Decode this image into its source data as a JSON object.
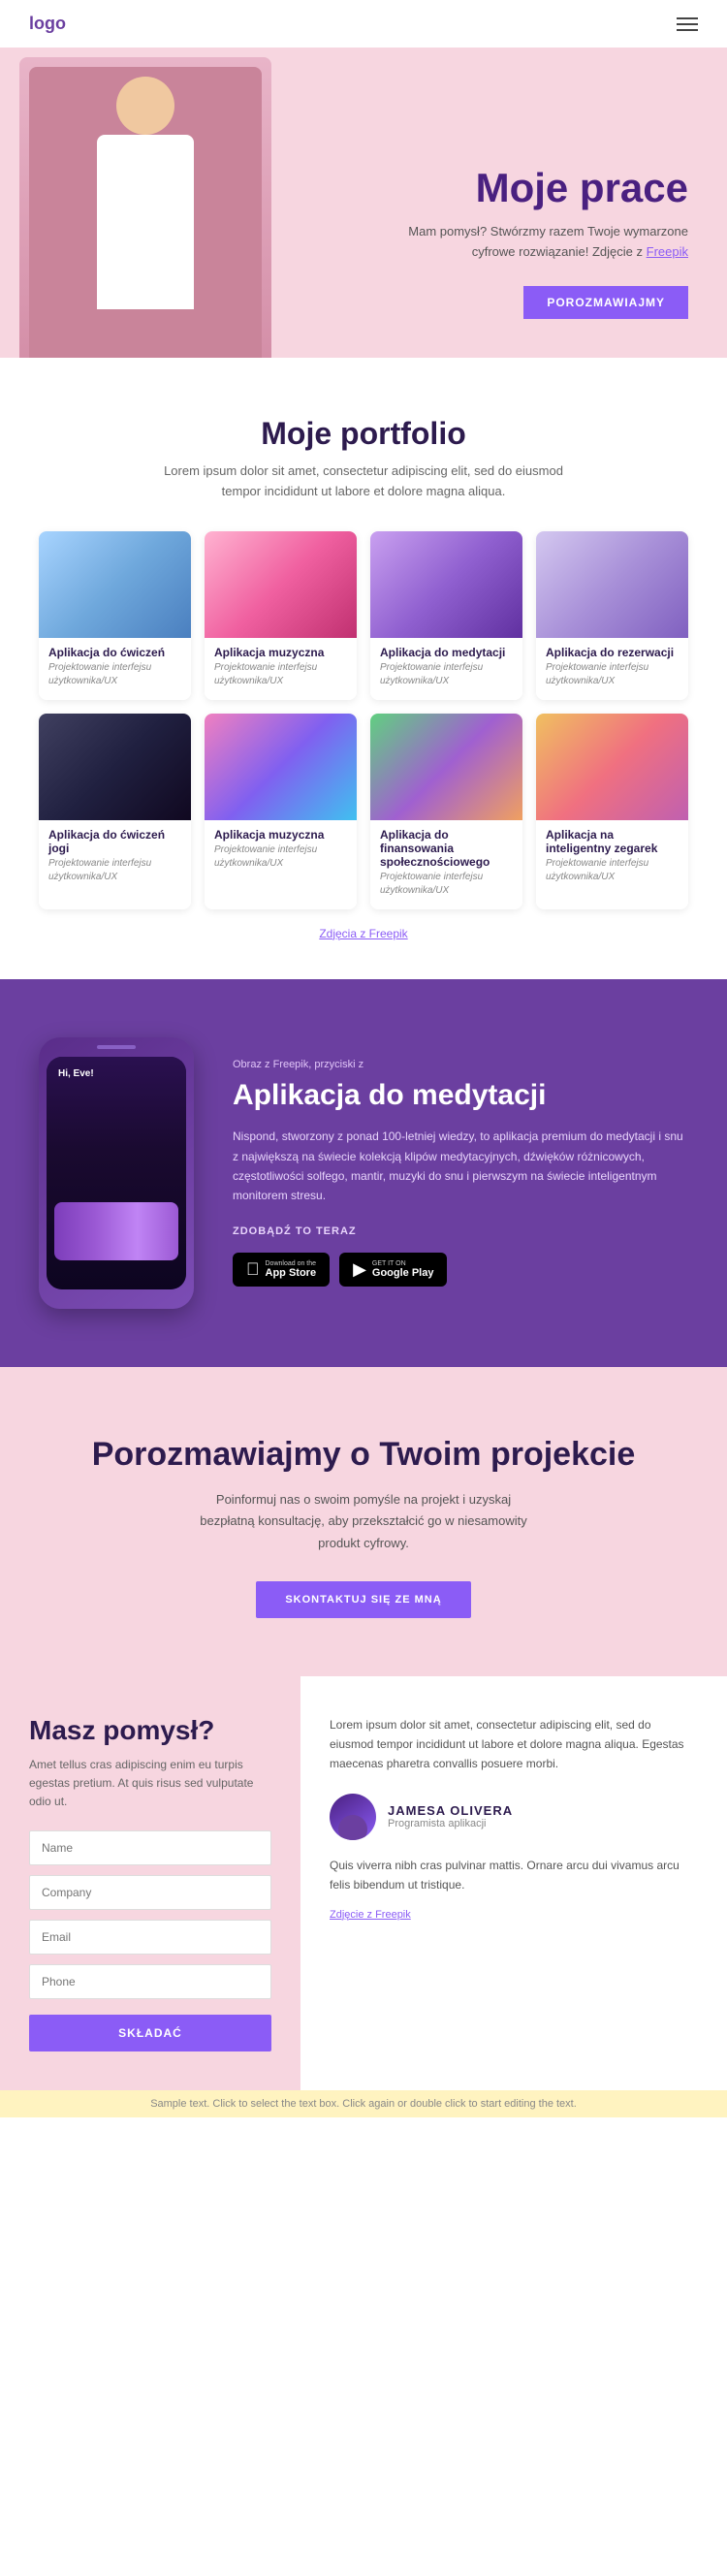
{
  "header": {
    "logo": "logo",
    "hamburger_label": "menu"
  },
  "hero": {
    "title": "Moje prace",
    "subtitle": "Mam pomysł? Stwórzmy razem Twoje wymarzone cyfrowe rozwiązanie! Zdjęcie z",
    "freepik_link": "Freepik",
    "button_label": "POROZMAWIAJMY"
  },
  "portfolio": {
    "title": "Moje portfolio",
    "subtitle": "Lorem ipsum dolor sit amet, consectetur adipiscing elit, sed do eiusmod tempor incididunt ut labore et dolore magna aliqua.",
    "freepik_link": "Zdjęcia z Freepik",
    "items": [
      {
        "title": "Aplikacja do ćwiczeń",
        "sub": "Projektowanie interfejsu użytkownika/UX",
        "thumb": "thumb-blue"
      },
      {
        "title": "Aplikacja muzyczna",
        "sub": "Projektowanie interfejsu użytkownika/UX",
        "thumb": "thumb-pink"
      },
      {
        "title": "Aplikacja do medytacji",
        "sub": "Projektowanie interfejsu użytkownika/UX",
        "thumb": "thumb-purple"
      },
      {
        "title": "Aplikacja do rezerwacji",
        "sub": "Projektowanie interfejsu użytkownika/UX",
        "thumb": "thumb-lavender"
      },
      {
        "title": "Aplikacja do ćwiczeń jogi",
        "sub": "Projektowanie interfejsu użytkownika/UX",
        "thumb": "thumb-dark"
      },
      {
        "title": "Aplikacja muzyczna",
        "sub": "Projektowanie interfejsu użytkownika/UX",
        "thumb": "thumb-colorful"
      },
      {
        "title": "Aplikacja do finansowania społecznościowego",
        "sub": "Projektowanie interfejsu użytkownika/UX",
        "thumb": "thumb-green-purple"
      },
      {
        "title": "Aplikacja na inteligentny zegarek",
        "sub": "Projektowanie interfejsu użytkownika/UX",
        "thumb": "thumb-orange-pink"
      }
    ]
  },
  "meditation": {
    "tag": "Obraz z Freepik, przyciski z",
    "title": "Aplikacja do medytacji",
    "description": "Nispond, stworzony z ponad 100-letniej wiedzy, to aplikacja premium do medytacji i snu z największą na świecie kolekcją klipów medytacyjnych, dźwięków różnicowych, częstotliwości solfego, mantir, muzyki do snu i pierwszym na świecie inteligentnym monitorem stresu.",
    "cta": "ZDOBĄDŹ TO TERAZ",
    "app_store_label": "App Store",
    "app_store_sub": "Download on the",
    "google_play_label": "Google Play",
    "google_play_sub": "GET IT ON"
  },
  "contact": {
    "title": "Porozmawiajmy o Twoim projekcie",
    "subtitle": "Poinformuj nas o swoim pomyśle na projekt i uzyskaj bezpłatną konsultację, aby przekształcić go w niesamowity produkt cyfrowy.",
    "button_label": "SKONTAKTUJ SIĘ ZE MNĄ"
  },
  "form_section": {
    "title": "Masz pomysł?",
    "description": "Amet tellus cras adipiscing enim eu turpis egestas pretium. At quis risus sed vulputate odio ut.",
    "fields": [
      {
        "placeholder": "Name"
      },
      {
        "placeholder": "Company"
      },
      {
        "placeholder": "Email"
      },
      {
        "placeholder": "Phone"
      }
    ],
    "submit_label": "SKŁADAĆ"
  },
  "testimonial": {
    "text": "Lorem ipsum dolor sit amet, consectetur adipiscing elit, sed do eiusmod tempor incididunt ut labore et dolore magna aliqua. Egestas maecenas pharetra convallis posuere morbi.",
    "author_name": "JAMESA OLIVERA",
    "author_role": "Programista aplikacji",
    "quote": "Quis viverra nibh cras pulvinar mattis. Ornare arcu dui vivamus arcu felis bibendum ut tristique.",
    "freepik_link": "Zdjęcie z Freepik"
  },
  "sample_bar": {
    "text": "Sample text. Click to select the text box. Click again or double click to start editing the text."
  }
}
